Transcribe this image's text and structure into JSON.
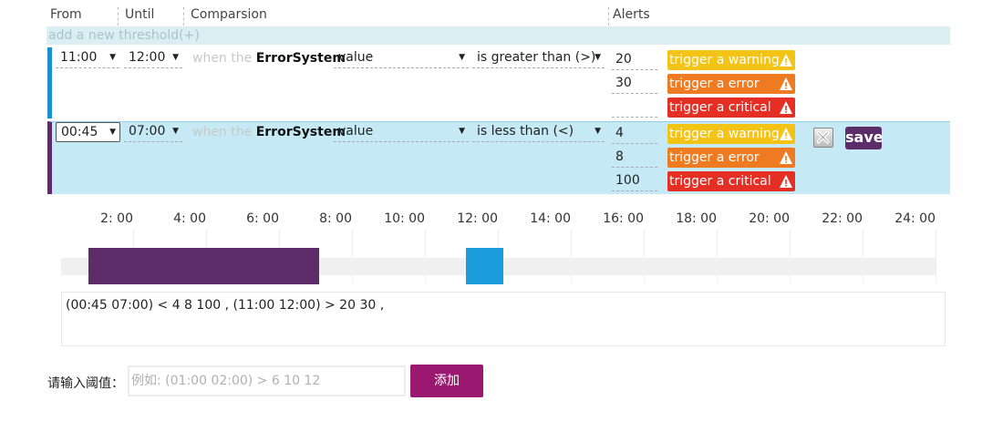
{
  "header": {
    "from": "From",
    "until": "Until",
    "comparison": "Comparsion",
    "alerts": "Alerts"
  },
  "add_link": "add a new threshold(+)",
  "rows": [
    {
      "from": "11:00",
      "until": "12:00",
      "when_prefix": "when the",
      "system": "ErrorSystem",
      "field": "value",
      "operator": "is greater than (>)",
      "alerts": [
        {
          "value": "20",
          "label": "trigger a warning"
        },
        {
          "value": "30",
          "label": "trigger a error"
        },
        {
          "value": "",
          "label": "trigger a critical"
        }
      ]
    },
    {
      "from": "00:45",
      "until": "07:00",
      "when_prefix": "when the",
      "system": "ErrorSystem",
      "field": "value",
      "operator": "is less than (<)",
      "alerts": [
        {
          "value": "4",
          "label": "trigger a warning"
        },
        {
          "value": "8",
          "label": "trigger a error"
        },
        {
          "value": "100",
          "label": "trigger a critical"
        }
      ],
      "save_label": "save"
    }
  ],
  "timeline": {
    "ticks": [
      "2: 00",
      "4: 00",
      "6: 00",
      "8: 00",
      "10: 00",
      "12: 00",
      "14: 00",
      "16: 00",
      "18: 00",
      "20: 00",
      "22: 00",
      "24: 00"
    ],
    "segments": [
      {
        "start": "00:45",
        "end": "07:00",
        "color": "#5c2d68"
      },
      {
        "start": "11:00",
        "end": "12:00",
        "color": "#1a9cdd"
      }
    ]
  },
  "summary_text": "(00:45 07:00) < 4 8 100 , (11:00 12:00) > 20 30 ,",
  "input": {
    "label": "请输入阈值：",
    "placeholder": "例如: (01:00 02:00) > 6 10 12",
    "button": "添加"
  },
  "colors": {
    "warning": "#f3c316",
    "error": "#ee7a22",
    "critical": "#e52f25",
    "accent_purple": "#5c2d68",
    "accent_blue": "#1a9cdd",
    "add_button": "#9b1870"
  }
}
